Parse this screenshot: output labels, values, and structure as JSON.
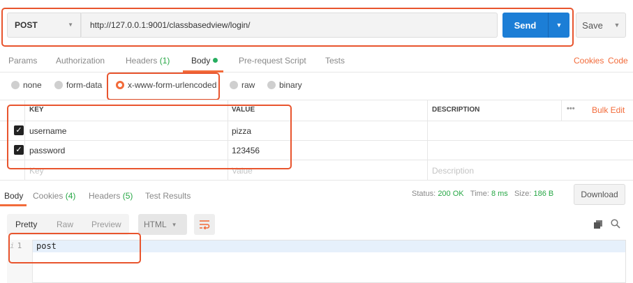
{
  "request": {
    "method": "POST",
    "url": "http://127.0.0.1:9001/classbasedview/login/",
    "send_label": "Send",
    "save_label": "Save"
  },
  "request_tabs": {
    "params": "Params",
    "authorization": "Authorization",
    "headers": "Headers",
    "headers_count": "(1)",
    "body": "Body",
    "pre_request": "Pre-request Script",
    "tests": "Tests",
    "cookies": "Cookies",
    "code": "Code"
  },
  "body_types": {
    "none": "none",
    "form_data": "form-data",
    "urlencoded": "x-www-form-urlencoded",
    "raw": "raw",
    "binary": "binary",
    "selected": "x-www-form-urlencoded"
  },
  "table": {
    "headers": {
      "key": "KEY",
      "value": "VALUE",
      "description": "DESCRIPTION",
      "more": "•••",
      "bulk_edit": "Bulk Edit"
    },
    "rows": [
      {
        "checked": true,
        "key": "username",
        "value": "pizza",
        "description": ""
      },
      {
        "checked": true,
        "key": "password",
        "value": "123456",
        "description": ""
      }
    ],
    "placeholders": {
      "key": "Key",
      "value": "Value",
      "description": "Description"
    }
  },
  "response_tabs": {
    "body": "Body",
    "cookies": "Cookies",
    "cookies_count": "(4)",
    "headers": "Headers",
    "headers_count": "(5)",
    "test_results": "Test Results"
  },
  "response_status": {
    "status_label": "Status:",
    "status_value": "200 OK",
    "time_label": "Time:",
    "time_value": "8 ms",
    "size_label": "Size:",
    "size_value": "186 B",
    "download_label": "Download"
  },
  "view": {
    "pretty": "Pretty",
    "raw": "Raw",
    "preview": "Preview",
    "format": "HTML"
  },
  "editor": {
    "info_marker": "i",
    "line_number": "1",
    "content": "post"
  },
  "colors": {
    "accent": "#f26b3a",
    "send_blue": "#1c7ed6",
    "status_green": "#27a745",
    "annotation_red": "#e8542d"
  }
}
